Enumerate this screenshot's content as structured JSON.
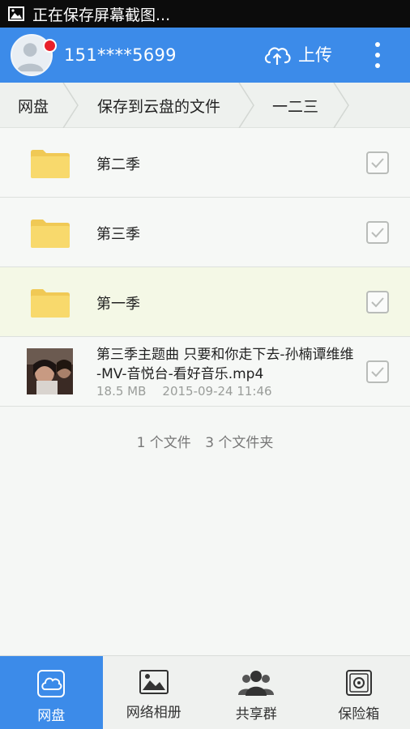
{
  "status_bar": {
    "text": "正在保存屏幕截图..."
  },
  "header": {
    "phone": "151****5699",
    "upload_label": "上传"
  },
  "breadcrumb": {
    "items": [
      "网盘",
      "保存到云盘的文件",
      "一二三"
    ]
  },
  "folders": [
    {
      "name": "第二季",
      "selected": false
    },
    {
      "name": "第三季",
      "selected": false
    },
    {
      "name": "第一季",
      "selected": true
    }
  ],
  "file": {
    "name": "第三季主题曲 只要和你走下去-孙楠谭维维 -MV-音悦台-看好音乐.mp4",
    "size": "18.5 MB",
    "date": "2015-09-24 11:46"
  },
  "summary": {
    "files": "1 个文件",
    "folders": "3 个文件夹"
  },
  "tabs": [
    {
      "label": "网盘",
      "icon": "cloud-disk-icon",
      "active": true
    },
    {
      "label": "网络相册",
      "icon": "photo-album-icon",
      "active": false
    },
    {
      "label": "共享群",
      "icon": "group-icon",
      "active": false
    },
    {
      "label": "保险箱",
      "icon": "safe-icon",
      "active": false
    }
  ],
  "colors": {
    "accent": "#3c8be9",
    "selected_row": "#f4f8e6",
    "notification": "#e8202a",
    "folder": "#f6d56a"
  }
}
